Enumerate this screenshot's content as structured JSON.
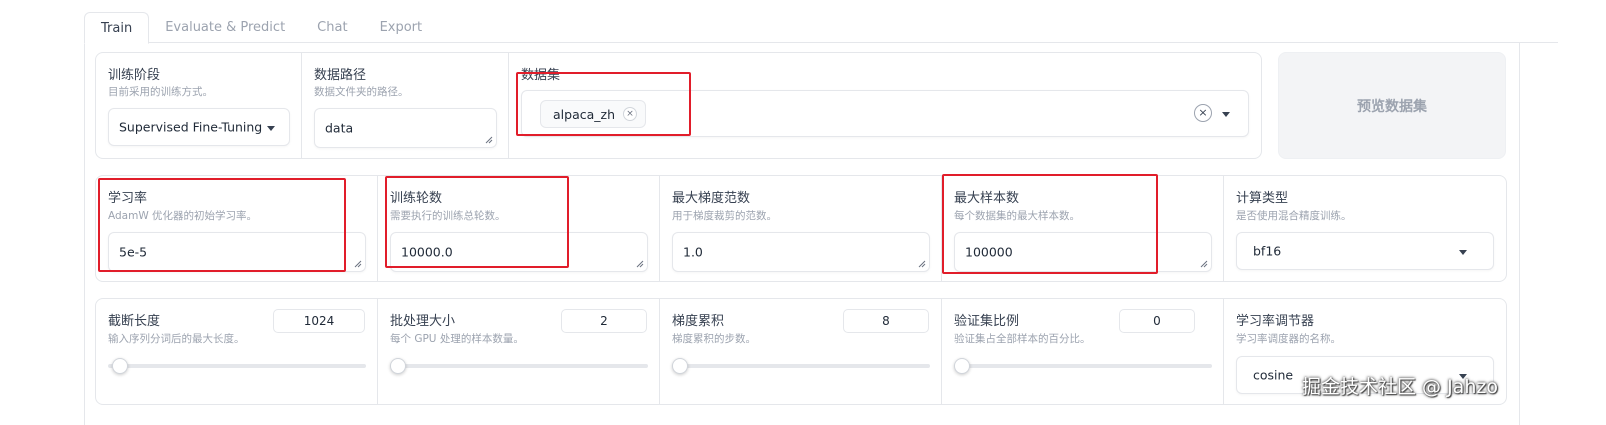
{
  "tabs": [
    {
      "label": "Train",
      "active": true
    },
    {
      "label": "Evaluate & Predict",
      "active": false
    },
    {
      "label": "Chat",
      "active": false
    },
    {
      "label": "Export",
      "active": false
    }
  ],
  "row1": {
    "stage": {
      "label": "训练阶段",
      "info": "目前采用的训练方式。",
      "value": "Supervised Fine-Tuning"
    },
    "dataset_dir": {
      "label": "数据路径",
      "info": "数据文件夹的路径。",
      "value": "data"
    },
    "dataset": {
      "label": "数据集",
      "chip": "alpaca_zh",
      "chip_remove": "×",
      "clear": "×"
    },
    "preview_button": "预览数据集"
  },
  "row2": {
    "learning_rate": {
      "label": "学习率",
      "info": "AdamW 优化器的初始学习率。",
      "value": "5e-5"
    },
    "epochs": {
      "label": "训练轮数",
      "info": "需要执行的训练总轮数。",
      "value": "10000.0"
    },
    "max_grad_norm": {
      "label": "最大梯度范数",
      "info": "用于梯度裁剪的范数。",
      "value": "1.0"
    },
    "max_samples": {
      "label": "最大样本数",
      "info": "每个数据集的最大样本数。",
      "value": "100000"
    },
    "compute_type": {
      "label": "计算类型",
      "info": "是否使用混合精度训练。",
      "value": "bf16"
    }
  },
  "row3": {
    "cutoff_len": {
      "label": "截断长度",
      "info": "输入序列分词后的最大长度。",
      "value": "1024",
      "slider_fraction": 0.02
    },
    "batch_size": {
      "label": "批处理大小",
      "info": "每个 GPU 处理的样本数量。",
      "value": "2",
      "slider_fraction": 0.0
    },
    "grad_accum": {
      "label": "梯度累积",
      "info": "梯度累积的步数。",
      "value": "8",
      "slider_fraction": 0.0
    },
    "val_size": {
      "label": "验证集比例",
      "info": "验证集占全部样本的百分比。",
      "value": "0",
      "slider_fraction": 0.0
    },
    "lr_scheduler": {
      "label": "学习率调节器",
      "info": "学习率调度器的名称。",
      "value": "cosine"
    }
  },
  "watermark": "掘金技术社区 @ Jahzo",
  "colors": {
    "highlight_box": "#e11d2a",
    "border": "#e5e7eb",
    "muted_text": "#9ca3af"
  }
}
